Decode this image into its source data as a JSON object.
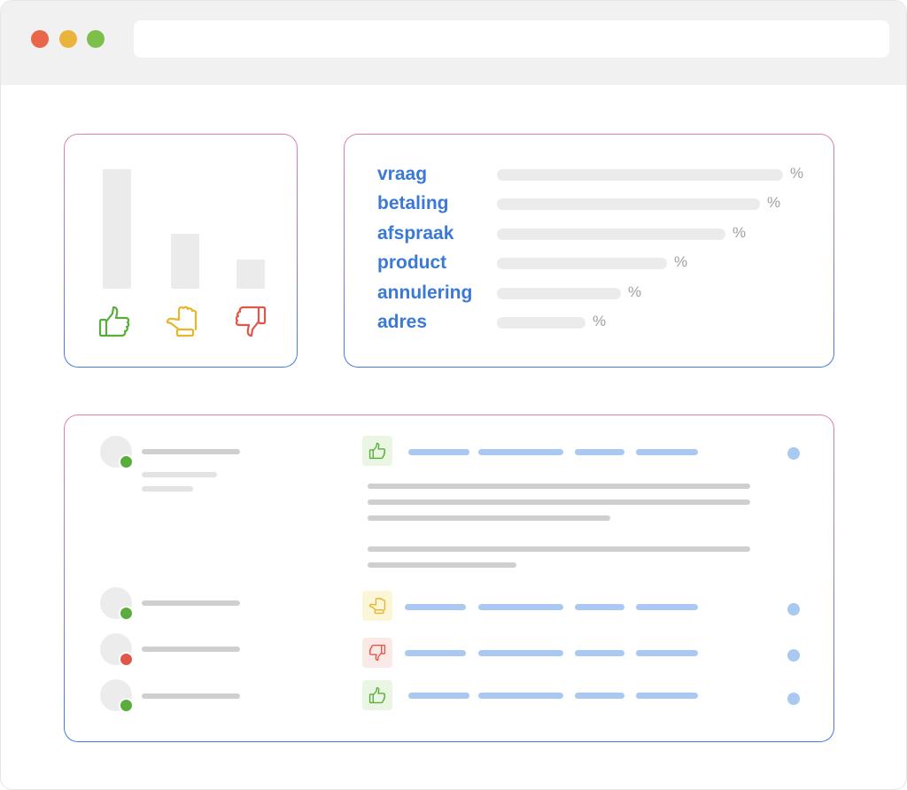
{
  "colors": {
    "positive": "#5aad3a",
    "neutral": "#e6b62b",
    "negative": "#e0574a",
    "accent": "#3b79d6",
    "placeholder_blue": "#a9c9f2"
  },
  "window": {
    "controls": [
      "close",
      "minimize",
      "maximize"
    ]
  },
  "votes": {
    "items": [
      {
        "icon": "thumbs-up-icon",
        "level": 1.0
      },
      {
        "icon": "thumb-sideways-icon",
        "level": 0.46
      },
      {
        "icon": "thumbs-down-icon",
        "level": 0.24
      }
    ]
  },
  "topics": {
    "items": [
      {
        "label": "vraag",
        "pct_symbol": "%"
      },
      {
        "label": "betaling",
        "pct_symbol": "%"
      },
      {
        "label": "afspraak",
        "pct_symbol": "%"
      },
      {
        "label": "product",
        "pct_symbol": "%"
      },
      {
        "label": "annulering",
        "pct_symbol": "%"
      },
      {
        "label": "adres",
        "pct_symbol": "%"
      }
    ]
  },
  "feedback_list": {
    "rows": [
      {
        "status": "positive",
        "sentiment_icon": "thumbs-up-icon",
        "expanded": true
      },
      {
        "status": "positive",
        "sentiment_icon": "thumb-sideways-icon",
        "expanded": false
      },
      {
        "status": "negative",
        "sentiment_icon": "thumbs-down-icon",
        "expanded": false
      },
      {
        "status": "positive",
        "sentiment_icon": "thumbs-up-icon",
        "expanded": false
      }
    ]
  }
}
